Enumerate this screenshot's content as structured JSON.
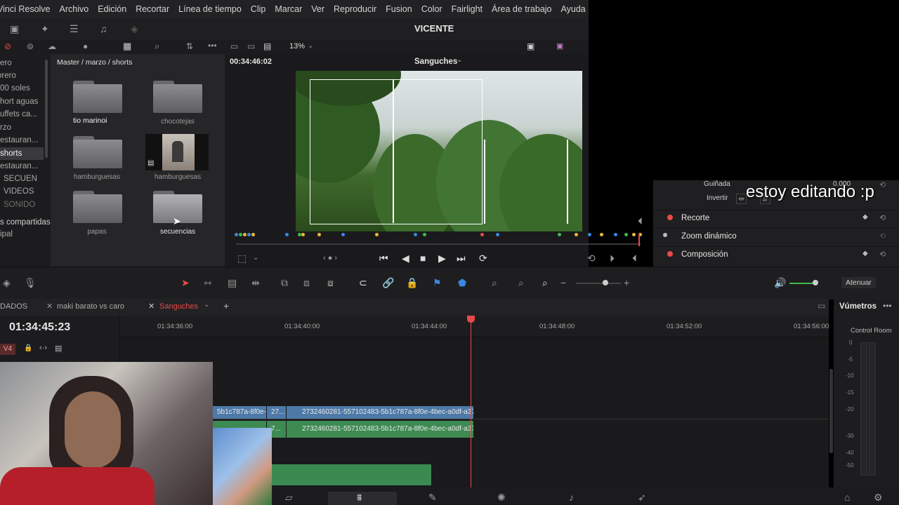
{
  "menu": [
    "Vinci Resolve",
    "Archivo",
    "Edición",
    "Recortar",
    "Línea de tiempo",
    "Clip",
    "Marcar",
    "Ver",
    "Reproducir",
    "Fusion",
    "Color",
    "Fairlight",
    "Área de trabajo",
    "Ayuda"
  ],
  "project_title": "VICENTE",
  "zoom_level": "13%",
  "bin": {
    "breadcrumb": "Master / marzo / shorts",
    "sidebar_items": [
      "ero",
      "orero",
      "00 soles",
      "hort aguas",
      "uffets ca...",
      "rzo",
      "estauran...",
      "shorts",
      "estauran...",
      "SECUEN",
      "VIDEOS",
      "SONIDO",
      "s compartidas",
      "ipal"
    ],
    "items": [
      {
        "label": "tio marinoi",
        "kind": "folder",
        "editing": true
      },
      {
        "label": "chocotejas",
        "kind": "folder"
      },
      {
        "label": "hamburguesas",
        "kind": "folder"
      },
      {
        "label": "hamburguesas",
        "kind": "clip"
      },
      {
        "label": "papas",
        "kind": "folder"
      },
      {
        "label": "secuencias",
        "kind": "folder"
      }
    ]
  },
  "viewer": {
    "timecode": "00:34:46:02",
    "timeline_name": "Sanguches"
  },
  "inspector": {
    "guinada_label": "Guiñada",
    "guinada_value": "0.000",
    "invertir_label": "Invertir",
    "sections": [
      {
        "label": "Recorte",
        "active": true
      },
      {
        "label": "Zoom dinámico",
        "active": false
      },
      {
        "label": "Composición",
        "active": true
      }
    ]
  },
  "overlay_text": "estoy editando :p",
  "timeline": {
    "tabs": [
      {
        "label": "DADOS",
        "active": false
      },
      {
        "label": "maki barato vs caro",
        "active": false
      },
      {
        "label": "Sanguches",
        "active": true
      }
    ],
    "current_timecode": "01:34:45:23",
    "track_label": "V4",
    "ruler_labels": [
      "01:34:36:00",
      "01:34:40:00",
      "01:34:44:00",
      "01:34:48:00",
      "01:34:52:00",
      "01:34:56:00"
    ],
    "clips": {
      "video_a": "5b1c787a-8f0e-...",
      "video_b": "27...",
      "video_main": "2732460281-557102483-5b1c787a-8f0e-4bec-a0df-a37...",
      "audio_main": "2732460281-557102483-5b1c787a-8f0e-4bec-a0df-a37...",
      "audio_b": "7..."
    },
    "atenuar_label": "Atenuar"
  },
  "meters": {
    "title": "Vúmetros",
    "room": "Control Room",
    "scale": [
      "0",
      "-5",
      "-10",
      "-15",
      "-20",
      "-30",
      "-40",
      "-50"
    ]
  },
  "colors": {
    "accent_red": "#e84b4b",
    "clip_blue": "#4d79a8",
    "clip_green": "#3e8a53",
    "playhead": "#e84b4b"
  }
}
